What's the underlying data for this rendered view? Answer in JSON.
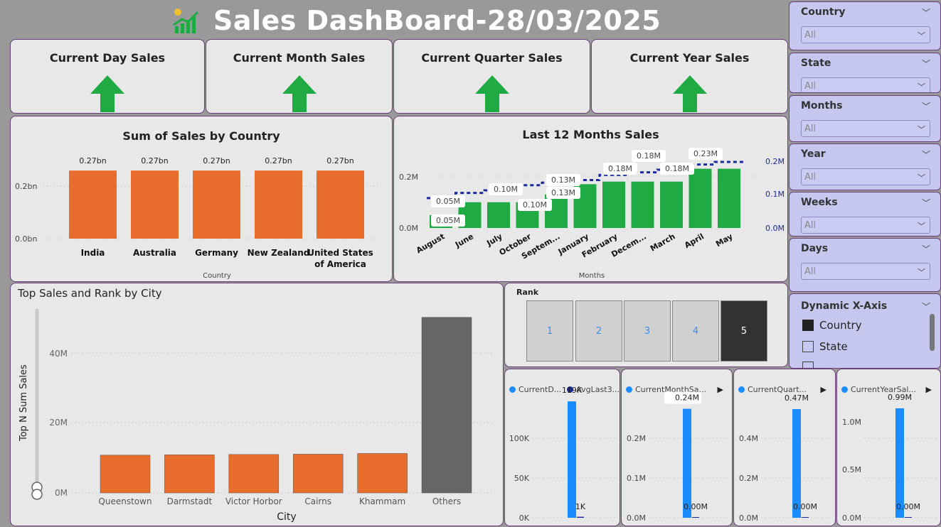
{
  "header": {
    "title": "Sales DashBoard-28/03/2025"
  },
  "kpis": [
    {
      "label": "Current Day Sales"
    },
    {
      "label": "Current Month Sales"
    },
    {
      "label": "Current Quarter Sales"
    },
    {
      "label": "Current Year Sales"
    }
  ],
  "country_chart": {
    "title": "Sum of Sales by Country",
    "xlabel": "Country",
    "yticks": [
      "0.0bn",
      "0.2bn"
    ]
  },
  "months_chart": {
    "title": "Last 12 Months Sales",
    "xlabel": "Months",
    "yticks_left": [
      "0.0M",
      "0.2M"
    ],
    "yticks_right": [
      "0.0M",
      "0.1M",
      "0.2M"
    ]
  },
  "city_chart": {
    "title": "Top Sales and Rank by City",
    "xlabel": "City",
    "ylabel": "Top N Sum Sales",
    "yticks": [
      "0M",
      "20M",
      "40M"
    ]
  },
  "rank": {
    "title": "Rank",
    "options": [
      "1",
      "2",
      "3",
      "4",
      "5"
    ],
    "selected": "5"
  },
  "mini_charts": [
    {
      "legend1": "CurrentD...",
      "legend2": "AvgLast3...",
      "yticks": [
        "0K",
        "50K",
        "100K"
      ],
      "label1": "119K",
      "label2": "1K"
    },
    {
      "legend1": "CurrentMonthSa...",
      "yticks": [
        "0.0M",
        "0.1M",
        "0.2M"
      ],
      "label1": "0.24M",
      "label2": "0.00M"
    },
    {
      "legend1": "CurrentQuart...",
      "yticks": [
        "0.0M",
        "0.2M",
        "0.4M"
      ],
      "label1": "0.47M",
      "label2": "0.00M"
    },
    {
      "legend1": "CurrentYearSal...",
      "yticks": [
        "0.0M",
        "0.5M",
        "1.0M"
      ],
      "label1": "0.99M",
      "label2": "0.00M"
    }
  ],
  "slicers": [
    {
      "label": "Country",
      "value": "All"
    },
    {
      "label": "State",
      "value": "All"
    },
    {
      "label": "Months",
      "value": "All"
    },
    {
      "label": "Year",
      "value": "All"
    },
    {
      "label": "Weeks",
      "value": "All"
    },
    {
      "label": "Days",
      "value": "All"
    }
  ],
  "dynamic_axis": {
    "title": "Dynamic X-Axis",
    "options": [
      {
        "label": "Country",
        "checked": true
      },
      {
        "label": "State",
        "checked": false
      }
    ]
  },
  "colors": {
    "orange": "#e86c2c",
    "green": "#1faa44",
    "navy": "#1a2a9c",
    "grey": "#666666",
    "blue": "#1a8cff"
  },
  "chart_data": [
    {
      "type": "bar",
      "title": "Sum of Sales by Country",
      "xlabel": "Country",
      "categories": [
        "India",
        "Australia",
        "Germany",
        "New Zealand",
        "United States of America"
      ],
      "values": [
        0.27,
        0.27,
        0.27,
        0.27,
        0.27
      ],
      "value_labels": [
        "0.27bn",
        "0.27bn",
        "0.27bn",
        "0.27bn",
        "0.27bn"
      ],
      "unit": "bn",
      "ylim": [
        0,
        0.4
      ]
    },
    {
      "type": "bar",
      "title": "Last 12 Months Sales",
      "xlabel": "Months",
      "categories": [
        "August",
        "June",
        "July",
        "October",
        "Septem...",
        "January",
        "February",
        "Decem...",
        "March",
        "April",
        "May"
      ],
      "series": [
        {
          "values": [
            0.05,
            0.1,
            0.1,
            0.1,
            0.13,
            0.17,
            0.18,
            0.18,
            0.18,
            0.23,
            0.23
          ]
        },
        {
          "values": [
            0.05,
            0.07,
            0.08,
            0.1,
            0.11,
            0.12,
            0.14,
            0.15,
            0.16,
            0.18,
            0.19
          ]
        }
      ],
      "value_labels": [
        "0.05M",
        "0.05M",
        "0.10M",
        "0.10M",
        "0.13M",
        "0.13M",
        "0.18M",
        "0.18M",
        "0.18M",
        "0.23M"
      ],
      "ylim": [
        0,
        0.35
      ]
    },
    {
      "type": "bar",
      "title": "Top Sales and Rank by City",
      "xlabel": "City",
      "ylabel": "Top N Sum Sales",
      "categories": [
        "Queenstown",
        "Darmstadt",
        "Victor Horbor",
        "Cairns",
        "Khammam",
        "Others"
      ],
      "values": [
        11.3,
        11.4,
        11.5,
        11.6,
        11.8,
        52.5
      ],
      "ylim": [
        0,
        55
      ]
    },
    {
      "type": "bar",
      "categories": [
        "CurrentD...",
        "AvgLast3..."
      ],
      "values": [
        119,
        1
      ],
      "unit": "K",
      "ylim": [
        0,
        130
      ]
    },
    {
      "type": "bar",
      "categories": [
        "CurrentMonthSa..."
      ],
      "values": [
        0.24,
        0.0
      ],
      "ylim": [
        0,
        0.28
      ]
    },
    {
      "type": "bar",
      "categories": [
        "CurrentQuart..."
      ],
      "values": [
        0.47,
        0.0
      ],
      "ylim": [
        0,
        0.55
      ]
    },
    {
      "type": "bar",
      "categories": [
        "CurrentYearSal..."
      ],
      "values": [
        0.99,
        0.0
      ],
      "ylim": [
        0,
        1.15
      ]
    }
  ]
}
